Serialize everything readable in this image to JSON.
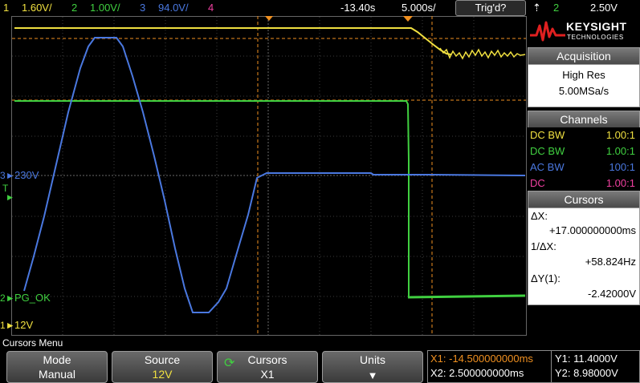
{
  "topbar": {
    "ch1_num": "1",
    "ch1_scale": "1.60V/",
    "ch2_num": "2",
    "ch2_scale": "1.00V/",
    "ch3_num": "3",
    "ch3_scale": "94.0V/",
    "ch4_num": "4",
    "time_offset": "-13.40s",
    "timebase": "5.000s/",
    "trigger_status": "Trig'd?",
    "trigger_source": "2",
    "trigger_level": "2.50V"
  },
  "screen": {
    "ch3_marker": "3",
    "ch3_label": "230V",
    "ch2_marker": "2",
    "ch2_label": "PG_OK",
    "ch1_marker": "1",
    "ch1_label": "12V"
  },
  "panel": {
    "logo_line1": "KEYSIGHT",
    "logo_line2": "TECHNOLOGIES",
    "acquisition_title": "Acquisition",
    "acquisition_mode": "High Res",
    "acquisition_rate": "5.00MSa/s",
    "channels_title": "Channels",
    "channels": [
      {
        "coupling": "DC BW",
        "probe": "1.00:1",
        "color": "#f0e040"
      },
      {
        "coupling": "DC BW",
        "probe": "1.00:1",
        "color": "#40d040"
      },
      {
        "coupling": "AC BW",
        "probe": "100:1",
        "color": "#4a78e0"
      },
      {
        "coupling": "DC",
        "probe": "1.00:1",
        "color": "#f040a0"
      }
    ],
    "cursors_title": "Cursors",
    "dx_label": "ΔX:",
    "dx_value": "+17.000000000ms",
    "inv_dx_label": "1/ΔX:",
    "inv_dx_value": "+58.824Hz",
    "dy_label": "ΔY(1):",
    "dy_value": "-2.42000V"
  },
  "menu": {
    "title": "Cursors Menu",
    "softkeys": [
      {
        "label": "Mode",
        "value": "Manual"
      },
      {
        "label": "Source",
        "value": "12V"
      },
      {
        "label": "Cursors",
        "value": "X1"
      },
      {
        "label": "Units",
        "value": ""
      }
    ]
  },
  "readout": {
    "x1": "X1: -14.500000000ms",
    "x2": "X2: 2.500000000ms",
    "y1": "Y1: 11.4000V",
    "y2": "Y2: 8.98000V"
  },
  "colors": {
    "ch1": "#f0e040",
    "ch2": "#40d040",
    "ch3": "#4a78e0",
    "ch4": "#f040a0",
    "cursor": "#f09020",
    "grid": "#555555"
  }
}
